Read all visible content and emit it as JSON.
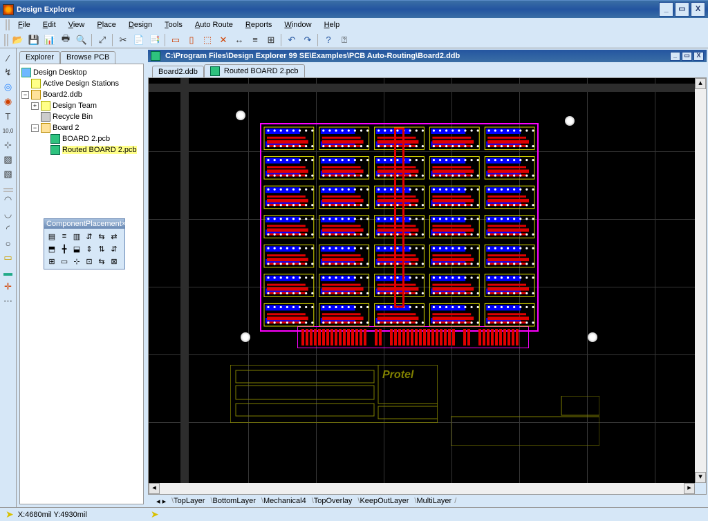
{
  "app": {
    "title": "Design Explorer"
  },
  "menus": [
    "File",
    "Edit",
    "View",
    "Place",
    "Design",
    "Tools",
    "Auto Route",
    "Reports",
    "Window",
    "Help"
  ],
  "panel_tabs": [
    "Explorer",
    "Browse PCB"
  ],
  "tree": {
    "root": "Design Desktop",
    "stations": "Active Design Stations",
    "ddb": "Board2.ddb",
    "team": "Design Team",
    "bin": "Recycle Bin",
    "board": "Board 2",
    "pcb1": "BOARD 2.pcb",
    "pcb2": "Routed BOARD 2.pcb"
  },
  "toolwin": {
    "title": "ComponentPlacement"
  },
  "document": {
    "path": "C:\\Program Files\\Design Explorer 99 SE\\Examples\\PCB Auto-Routing\\Board2.ddb",
    "tabs": [
      "Board2.ddb",
      "Routed BOARD 2.pcb"
    ]
  },
  "layers": [
    "TopLayer",
    "BottomLayer",
    "Mechanical4",
    "TopOverlay",
    "KeepOutLayer",
    "MultiLayer"
  ],
  "silk_brand": "Protel",
  "status": {
    "coords": "X:4680mil Y:4930mil"
  }
}
